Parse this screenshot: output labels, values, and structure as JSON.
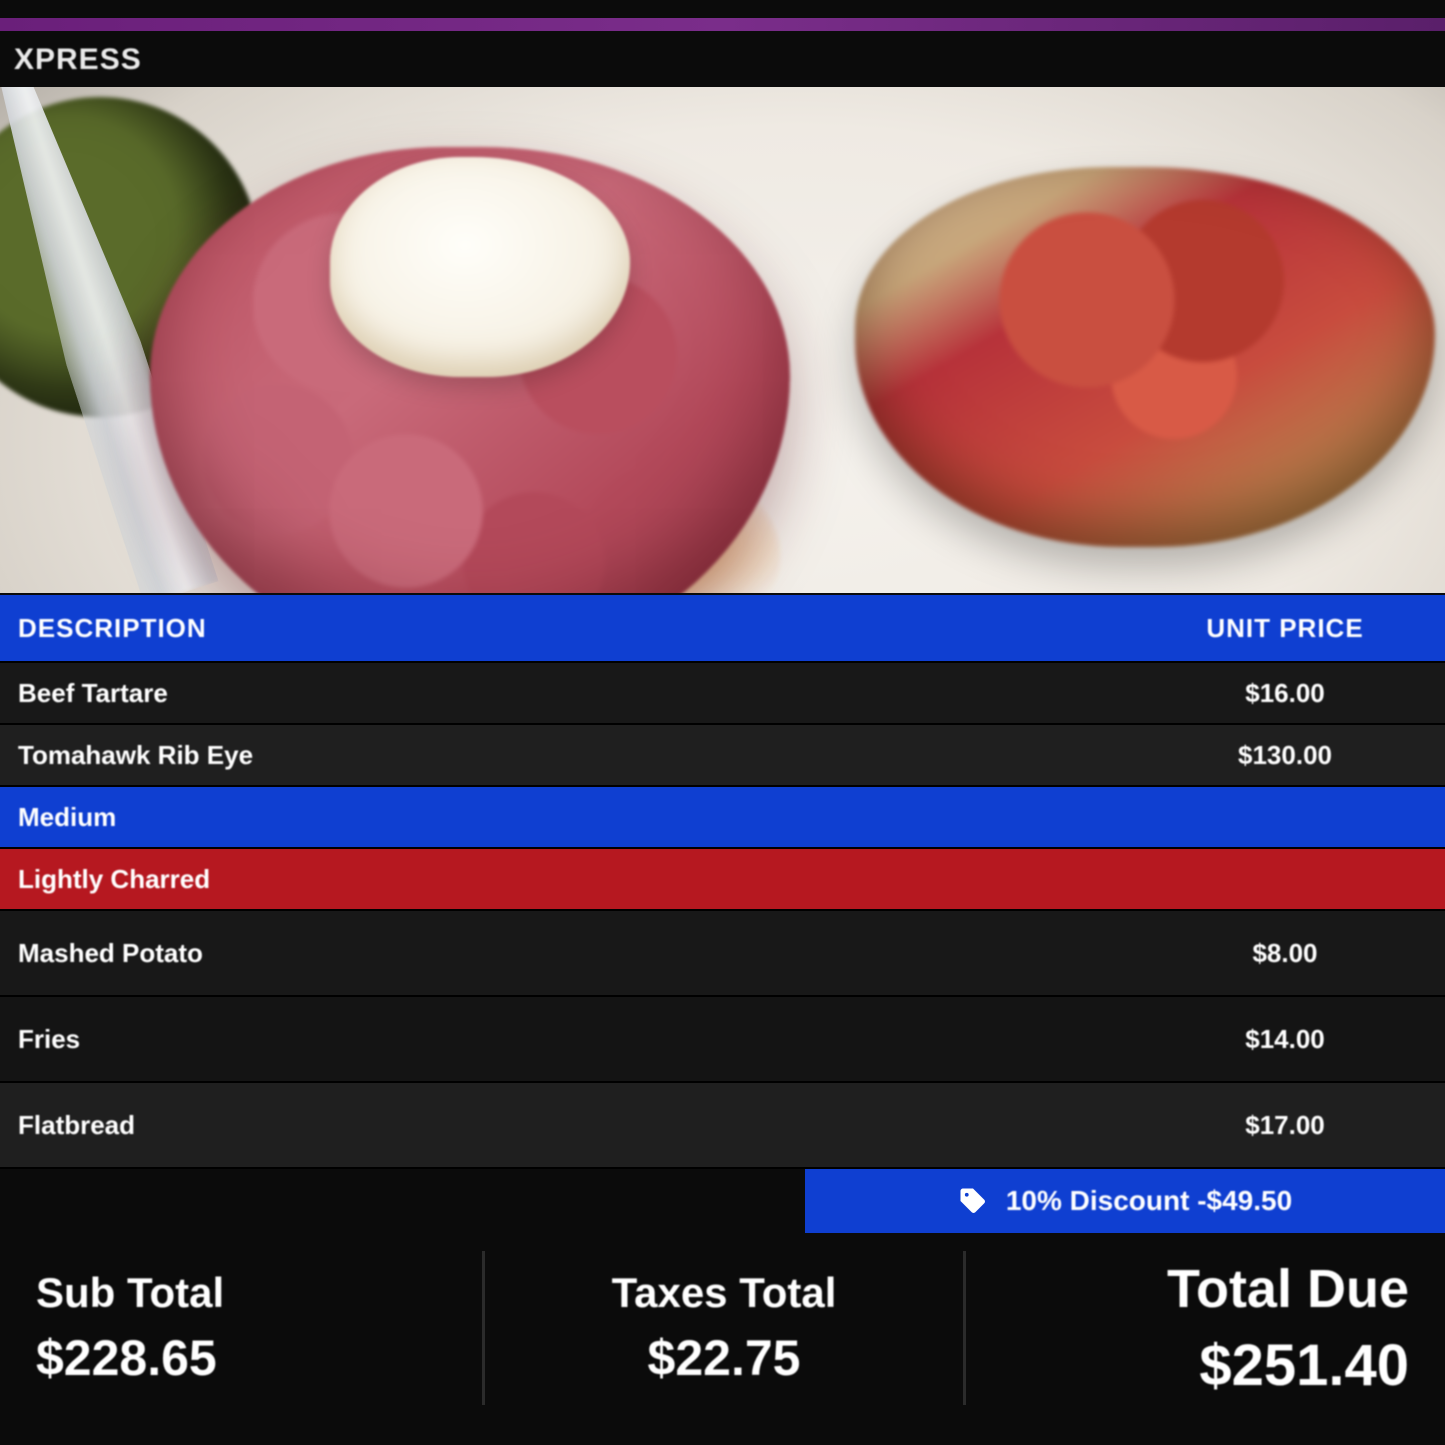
{
  "brand": "XPRESS",
  "table_headers": {
    "description": "DESCRIPTION",
    "unit_price": "UNIT PRICE"
  },
  "items": [
    {
      "desc": "Beef Tartare",
      "price": "$16.00",
      "style": "r-dark1"
    },
    {
      "desc": "Tomahawk Rib Eye",
      "price": "$130.00",
      "style": "r-dark2"
    },
    {
      "desc": "Medium",
      "price": "",
      "style": "r-blue"
    },
    {
      "desc": "Lightly Charred",
      "price": "",
      "style": "r-red"
    },
    {
      "desc": "Mashed Potato",
      "price": "$8.00",
      "style": "r-dark1 r-darktall"
    },
    {
      "desc": "Fries",
      "price": "$14.00",
      "style": "r-dark3 r-darktall"
    },
    {
      "desc": "Flatbread",
      "price": "$17.00",
      "style": "r-dark2 r-darktall"
    }
  ],
  "discount": {
    "icon": "tag-icon",
    "text": "10% Discount -$49.50"
  },
  "totals": {
    "subtotal_label": "Sub Total",
    "subtotal_value": "$228.65",
    "taxes_label": "Taxes Total",
    "taxes_value": "$22.75",
    "due_label": "Total Due",
    "due_value": "$251.40"
  }
}
